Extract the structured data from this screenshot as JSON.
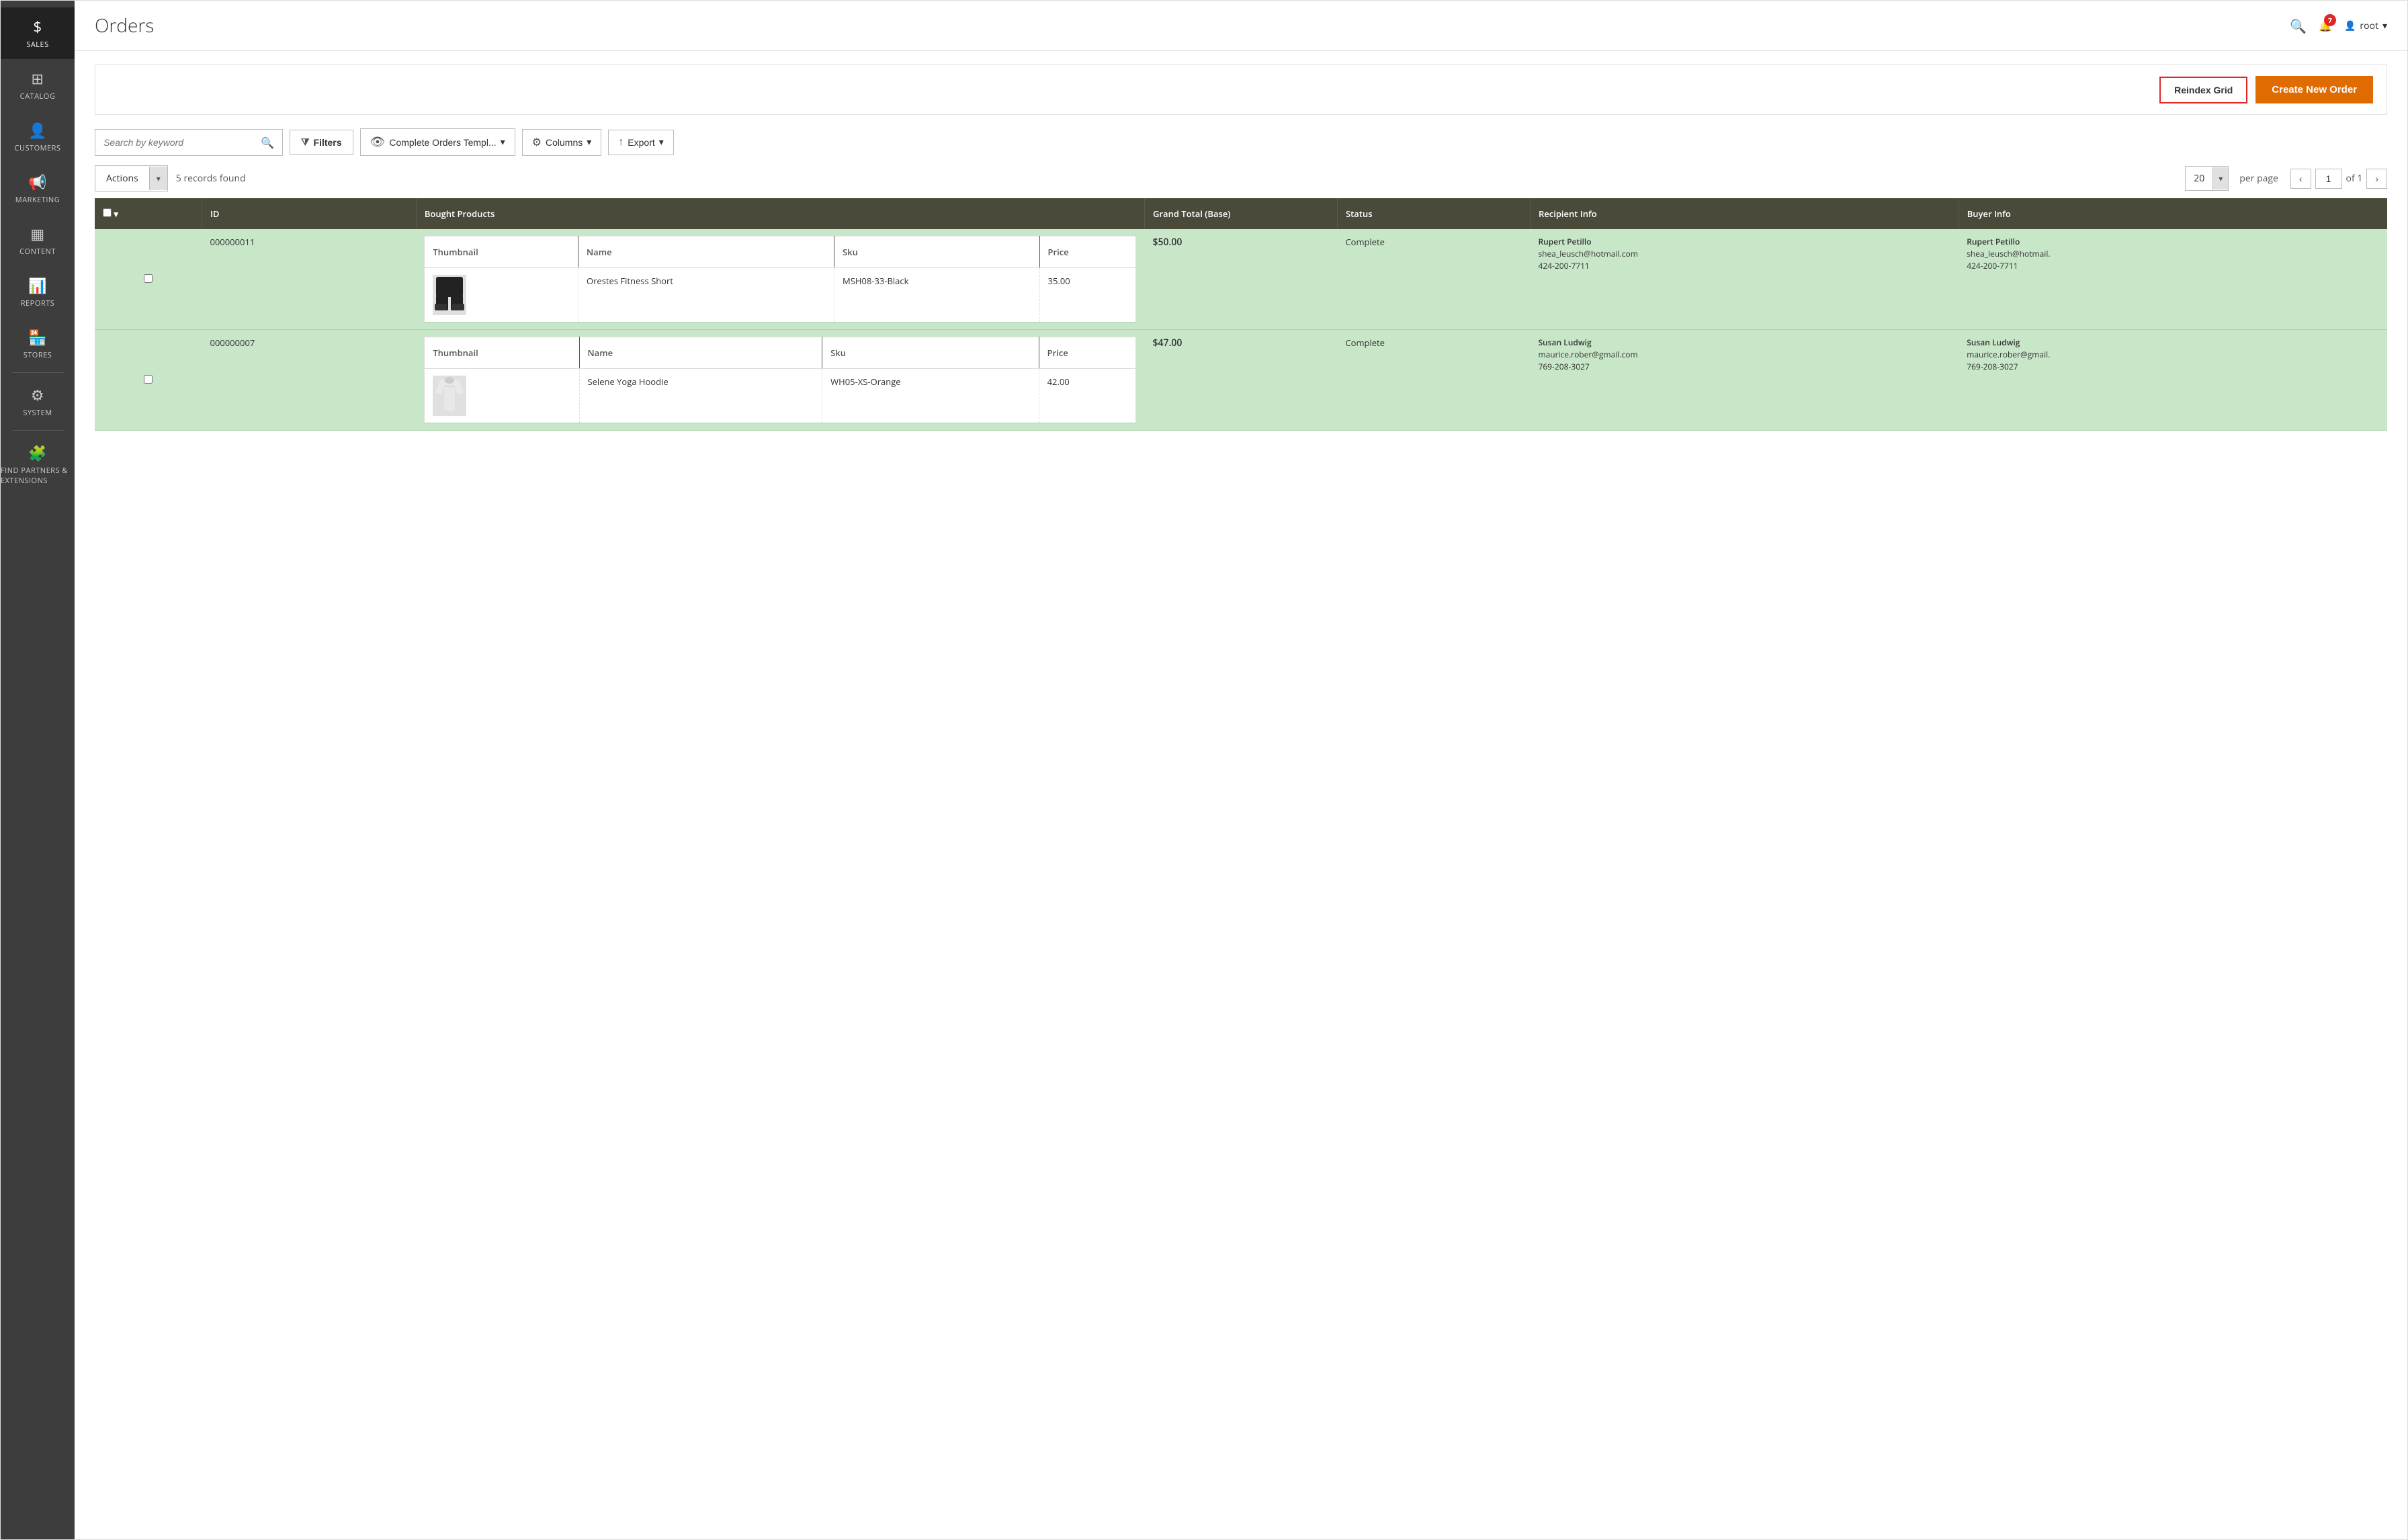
{
  "sidebar": {
    "items": [
      {
        "id": "sales",
        "label": "SALES",
        "icon": "💲",
        "active": true
      },
      {
        "id": "catalog",
        "label": "CATALOG",
        "icon": "📦",
        "active": false
      },
      {
        "id": "customers",
        "label": "CUSTOMERS",
        "icon": "👤",
        "active": false
      },
      {
        "id": "marketing",
        "label": "MARKETING",
        "icon": "📢",
        "active": false
      },
      {
        "id": "content",
        "label": "CONTENT",
        "icon": "▦",
        "active": false
      },
      {
        "id": "reports",
        "label": "REPORTS",
        "icon": "📊",
        "active": false
      },
      {
        "id": "stores",
        "label": "STORES",
        "icon": "🏪",
        "active": false
      },
      {
        "id": "system",
        "label": "SYSTEM",
        "icon": "⚙",
        "active": false
      },
      {
        "id": "partners",
        "label": "FIND PARTNERS & EXTENSIONS",
        "icon": "🧩",
        "active": false
      }
    ]
  },
  "header": {
    "title": "Orders",
    "notification_count": "7",
    "user": "root"
  },
  "top_bar": {
    "reindex_label": "Reindex Grid",
    "create_label": "Create New Order"
  },
  "search": {
    "placeholder": "Search by keyword"
  },
  "toolbar": {
    "filters_label": "Filters",
    "view_label": "Complete Orders Templ...",
    "columns_label": "Columns",
    "export_label": "Export",
    "actions_label": "Actions",
    "records_count": "5 records found",
    "per_page": "20",
    "per_page_label": "per page",
    "page_num": "1",
    "page_of": "of 1"
  },
  "table": {
    "columns": [
      {
        "id": "checkbox",
        "label": ""
      },
      {
        "id": "id",
        "label": "ID"
      },
      {
        "id": "products",
        "label": "Bought Products"
      },
      {
        "id": "grand_total",
        "label": "Grand Total (Base)"
      },
      {
        "id": "status",
        "label": "Status"
      },
      {
        "id": "recipient",
        "label": "Recipient Info"
      },
      {
        "id": "buyer",
        "label": "Buyer Info"
      }
    ],
    "product_cols": [
      "Thumbnail",
      "Name",
      "Sku",
      "Price"
    ],
    "rows": [
      {
        "id": "000000011",
        "grand_total": "$50.00",
        "status": "Complete",
        "product": {
          "name": "Orestes Fitness Short",
          "sku": "MSH08-33-Black",
          "price": "35.00",
          "thumb_type": "shorts"
        },
        "recipient": {
          "name": "Rupert Petillo",
          "email": "shea_leusch@hotmail.com",
          "phone": "424-200-7711"
        },
        "buyer": {
          "name": "Rupert Petillo",
          "email": "shea_leusch@hotmail.",
          "phone": "424-200-7711"
        }
      },
      {
        "id": "000000007",
        "grand_total": "$47.00",
        "status": "Complete",
        "product": {
          "name": "Selene Yoga Hoodie",
          "sku": "WH05-XS-Orange",
          "price": "42.00",
          "thumb_type": "hoodie"
        },
        "recipient": {
          "name": "Susan Ludwig",
          "email": "maurice.rober@gmail.com",
          "phone": "769-208-3027"
        },
        "buyer": {
          "name": "Susan Ludwig",
          "email": "maurice.rober@gmail.",
          "phone": "769-208-3027"
        }
      }
    ]
  },
  "icons": {
    "search": "🔍",
    "filter": "⧩",
    "eye": "👁",
    "gear": "⚙",
    "export_arrow": "↑",
    "chevron_down": "▾",
    "chevron_left": "‹",
    "chevron_right": "›",
    "user": "👤",
    "bell": "🔔",
    "dollar": "💲",
    "catalog": "📦",
    "customers": "👤",
    "marketing": "📢",
    "content": "▦",
    "reports": "📊",
    "stores": "🏪",
    "system": "⚙",
    "partners": "🧩"
  }
}
